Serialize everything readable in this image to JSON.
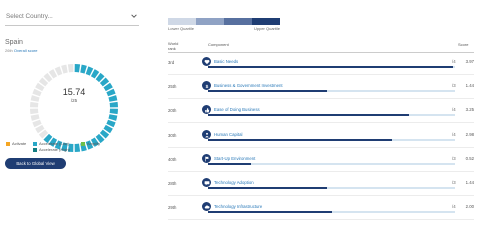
{
  "colors": {
    "navy": "#1f3d73",
    "link": "#2878b8",
    "activate": "#f5a623",
    "accelerate_low": "#29a7c7",
    "amplify": "#6cbf4a",
    "accelerate_high": "#157d82",
    "donut_track": "#e6e6e6"
  },
  "selector": {
    "placeholder": "Select Country...",
    "icon": "chevron-down-icon"
  },
  "country": {
    "name": "Spain",
    "overall_prefix": "26th",
    "overall_link": "Overall score",
    "score": "15.74",
    "score_max": "/25",
    "score_value": 15.74,
    "score_total": 25
  },
  "legend": [
    {
      "label": "Activate",
      "color": "#f5a623"
    },
    {
      "label": "Accelerate (Low)",
      "color": "#29a7c7"
    },
    {
      "label": "Amplify",
      "color": "#6cbf4a"
    },
    {
      "label": "Accelerate (High)",
      "color": "#157d82"
    }
  ],
  "back_button": "Back to Global View",
  "quartile": {
    "lower_label": "Lower Quartile",
    "upper_label": "Upper Quartile",
    "colors": [
      "#cfd8e6",
      "#8fa2c4",
      "#57709f",
      "#1f3d73"
    ]
  },
  "table": {
    "header_rank_1": "World",
    "header_rank_2": "rank",
    "header_component": "Component",
    "header_score": "Score",
    "rows": [
      {
        "rank": "3rd",
        "component": "Basic Needs",
        "max": "/4",
        "score": "3.97",
        "value": 3.97,
        "total": 4,
        "icon": "heart-icon"
      },
      {
        "rank": "25th",
        "component": "Business & Government Investment",
        "max": "/3",
        "score": "1.44",
        "value": 1.44,
        "total": 3,
        "icon": "dollar-icon"
      },
      {
        "rank": "20th",
        "component": "Ease of Doing Business",
        "max": "/4",
        "score": "3.25",
        "value": 3.25,
        "total": 4,
        "icon": "thumbs-up-icon"
      },
      {
        "rank": "30th",
        "component": "Human Capital",
        "max": "/4",
        "score": "2.98",
        "value": 2.98,
        "total": 4,
        "icon": "person-icon"
      },
      {
        "rank": "40th",
        "component": "Start-Up Environment",
        "max": "/3",
        "score": "0.52",
        "value": 0.52,
        "total": 3,
        "icon": "flag-icon"
      },
      {
        "rank": "28th",
        "component": "Technology Adoption",
        "max": "/3",
        "score": "1.44",
        "value": 1.44,
        "total": 3,
        "icon": "chat-bubble-icon"
      },
      {
        "rank": "29th",
        "component": "Technology Infrastructure",
        "max": "/4",
        "score": "2.00",
        "value": 2.0,
        "total": 4,
        "icon": "cloud-icon"
      }
    ]
  }
}
